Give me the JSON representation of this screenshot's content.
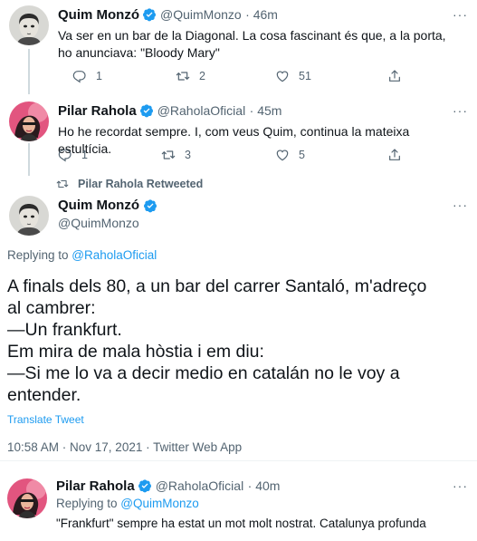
{
  "tweets": [
    {
      "name": "Quim Monzó",
      "handle": "@QuimMonzo",
      "time": "· 46m",
      "text": "Va ser en un bar de la Diagonal. La cosa fascinant és que, a la porta, ho anunciava: \"Bloody Mary\"",
      "replies": "1",
      "retweets": "2",
      "likes": "51"
    },
    {
      "name": "Pilar Rahola",
      "handle": "@RaholaOficial",
      "time": "· 45m",
      "text": "Ho he recordat sempre. I, com veus Quim, continua la mateixa estultícia.",
      "replies": "1",
      "retweets": "3",
      "likes": "5"
    }
  ],
  "retweet_context": "Pilar Rahola Retweeted",
  "main_tweet": {
    "name": "Quim Monzó",
    "handle": "@QuimMonzo",
    "replying_label": "Replying to ",
    "replying_handle": "@RaholaOficial",
    "lines": [
      "A finals dels 80, a un bar del carrer Santaló, m'adreço",
      "al cambrer:",
      "—Un frankfurt.",
      "Em mira de mala hòstia i em diu:",
      "—Si me lo va a decir medio en catalán no le voy a",
      "entender."
    ],
    "translate": "Translate Tweet",
    "meta": "10:58 AM · Nov 17, 2021 · Twitter Web App"
  },
  "reply": {
    "name": "Pilar Rahola",
    "handle": "@RaholaOficial",
    "time": "· 40m",
    "replying_label": "Replying to ",
    "replying_handle": "@QuimMonzo",
    "text": "\"Frankfurt\" sempre ha estat un mot molt nostrat. Catalunya profunda"
  },
  "colors": {
    "accent": "#1d9bf0",
    "secondary_text": "#536471",
    "thread_line": "#cfd9de"
  }
}
